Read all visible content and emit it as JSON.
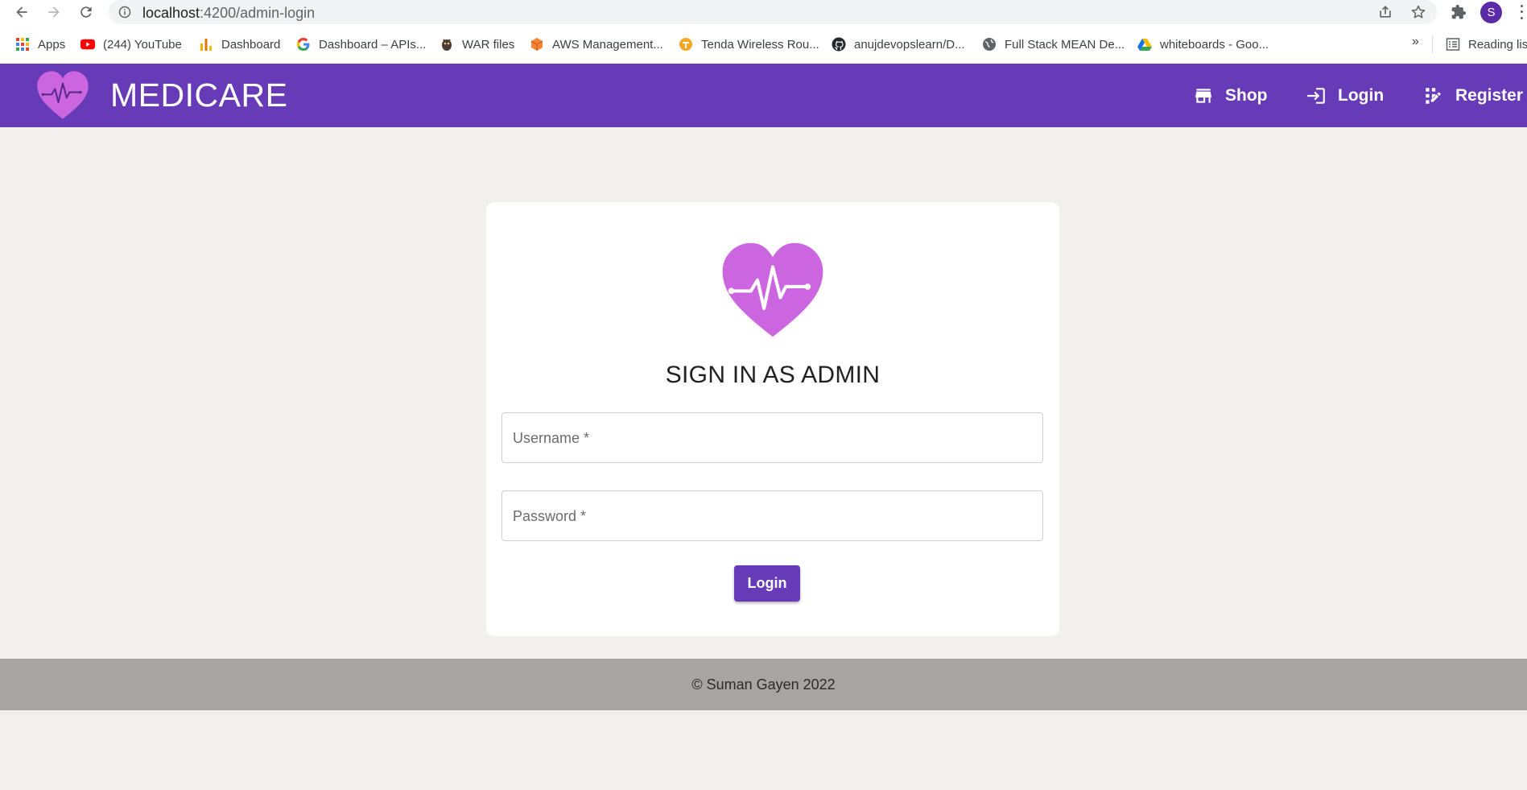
{
  "browser": {
    "url_host": "localhost",
    "url_path": ":4200/admin-login",
    "profile_initial": "S",
    "bookmarks_overflow": "»",
    "bookmarks": [
      {
        "label": "Apps",
        "icon": "apps-grid-icon"
      },
      {
        "label": "(244) YouTube",
        "icon": "youtube-icon"
      },
      {
        "label": "Dashboard",
        "icon": "dashboard-bars-icon"
      },
      {
        "label": "Dashboard – APIs...",
        "icon": "google-icon"
      },
      {
        "label": "WAR files",
        "icon": "tomcat-icon"
      },
      {
        "label": "AWS Management...",
        "icon": "aws-cube-icon"
      },
      {
        "label": "Tenda Wireless Rou...",
        "icon": "tenda-icon"
      },
      {
        "label": "anujdevopslearn/D...",
        "icon": "github-icon"
      },
      {
        "label": "Full Stack MEAN De...",
        "icon": "globe-icon"
      },
      {
        "label": "whiteboards - Goo...",
        "icon": "google-drive-icon"
      },
      {
        "label": "Reading list",
        "icon": "reading-list-icon"
      }
    ]
  },
  "app": {
    "brand": "MEDICARE",
    "nav": {
      "shop": "Shop",
      "login": "Login",
      "register": "Register"
    }
  },
  "login_card": {
    "title": "SIGN IN AS ADMIN",
    "username_placeholder": "Username *",
    "password_placeholder": "Password *",
    "username_value": "",
    "password_value": "",
    "submit_label": "Login"
  },
  "footer": {
    "text": "© Suman Gayen 2022"
  },
  "colors": {
    "primary": "#673ab7",
    "logo_heart": "#cc66e0",
    "page_background": "#f1f0ef",
    "footer_background": "#a7a4a3"
  }
}
